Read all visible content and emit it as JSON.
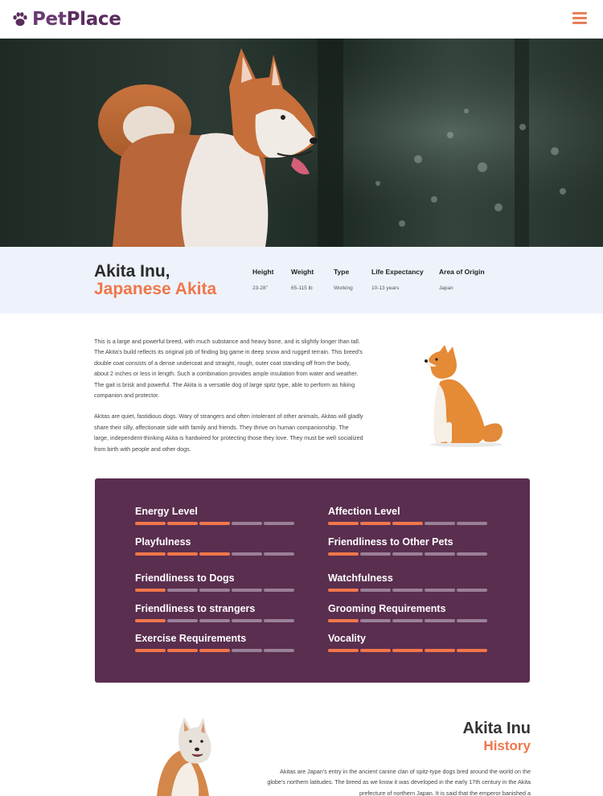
{
  "header": {
    "logo_text_pet": "Pet",
    "logo_text_place": "Place",
    "logo_icon": "paw-icon",
    "menu_icon": "hamburger-menu-icon"
  },
  "hero": {
    "image_alt": "Akita dog standing in forest"
  },
  "breed": {
    "name": "Akita Inu,",
    "alt_name": "Japanese Akita",
    "stats": [
      {
        "label": "Height",
        "value": "23-28\""
      },
      {
        "label": "Weight",
        "value": "65-115 lb"
      },
      {
        "label": "Type",
        "value": "Working"
      },
      {
        "label": "Life Expectancy",
        "value": "10-13 years"
      },
      {
        "label": "Area of Origin",
        "value": "Japan"
      }
    ]
  },
  "description": {
    "p1": "This is a large and powerful breed, with much substance and heavy bone, and is slightly longer than tall. The Akita's build reflects its original job of finding big game in deep snow and rugged terrain. This breed's double coat consists of a dense undercoat and straight, rough, outer coat standing off from the body, about 2 inches or less in length. Such a combination provides ample insulation from water and weather. The gait is brisk and powerful. The Akita is a versatile dog of large spitz type, able to perform as hiking companion and protector.",
    "p2": "Akitas are quiet, fastidious dogs. Wary of strangers and often intolerant of other animals, Akitas will gladly share their silly, affectionate side with family and friends. They thrive on human companionship. The large, independent-thinking Akita is hardwired for protecting those they love. They must be well socialized from birth with people and other dogs."
  },
  "traits": [
    {
      "name": "Energy Level",
      "level": 3
    },
    {
      "name": "Affection Level",
      "level": 3
    },
    {
      "name": "Playfulness",
      "level": 3
    },
    {
      "name": "Friendliness to Other Pets",
      "level": 1
    },
    {
      "name": "Friendliness to Dogs",
      "level": 1
    },
    {
      "name": "Watchfulness",
      "level": 1
    },
    {
      "name": "Friendliness to strangers",
      "level": 1
    },
    {
      "name": "Grooming Requirements",
      "level": 1
    },
    {
      "name": "Exercise Requirements",
      "level": 3
    },
    {
      "name": "Vocality",
      "level": 5
    }
  ],
  "history": {
    "title": "Akita Inu",
    "subtitle": "History",
    "text": "Akitas are Japan's entry in the ancient canine clan of spitz-type dogs bred around the world on the globe's northern latitudes. The breed as we know it was developed in the early 17th century in the Akita prefecture of northern Japan. It is said that the emperor banished a"
  },
  "colors": {
    "accent": "#f0764b",
    "brand": "#5a2d5e",
    "traits_bg": "#5a2e4f",
    "info_bg": "#eef3fb"
  }
}
